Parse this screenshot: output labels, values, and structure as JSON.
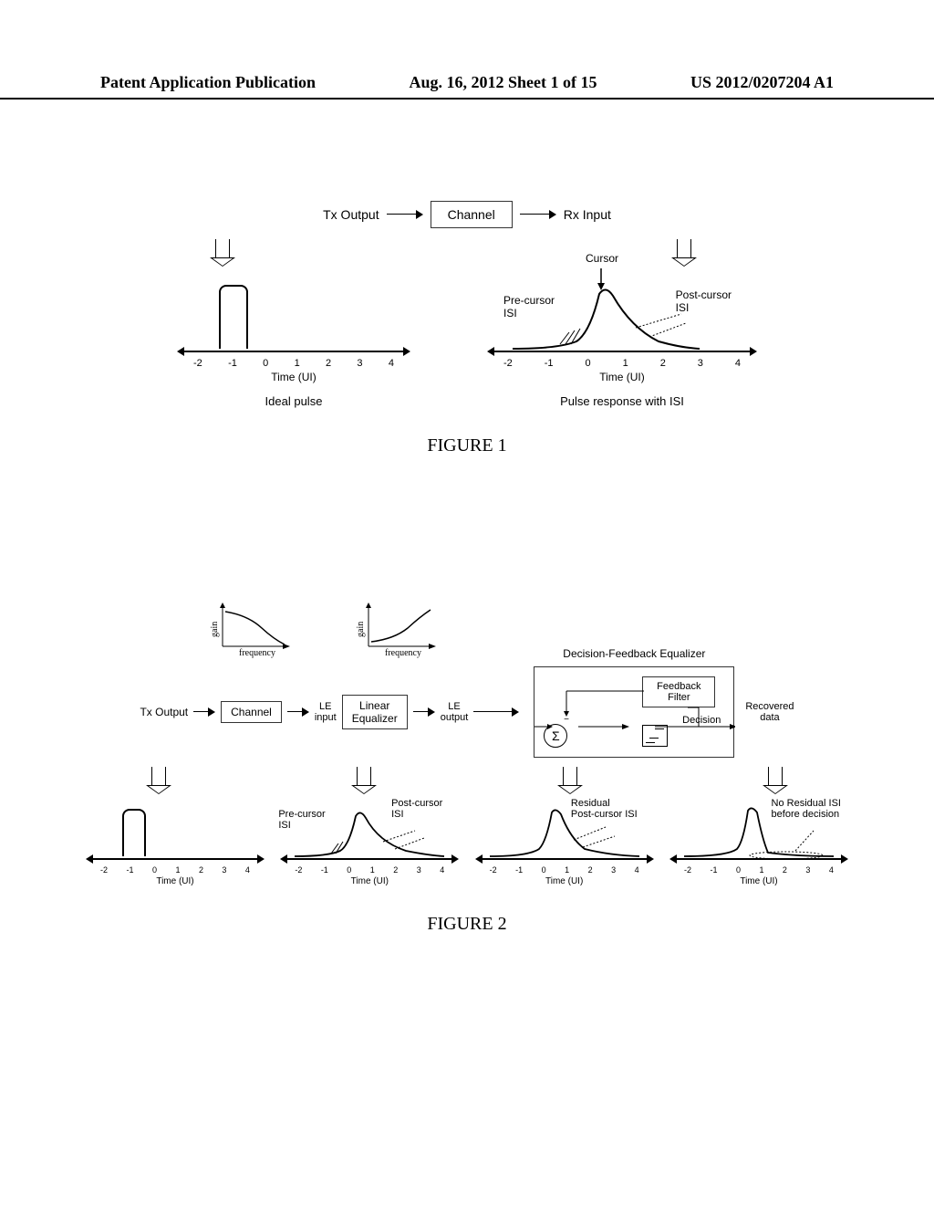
{
  "header": {
    "left": "Patent Application Publication",
    "center": "Aug. 16, 2012  Sheet 1 of 15",
    "right": "US 2012/0207204 A1"
  },
  "fig1": {
    "tx": "Tx Output",
    "channel": "Channel",
    "rx": "Rx Input",
    "cursor": "Cursor",
    "pre": "Pre-cursor\nISI",
    "post": "Post-cursor\nISI",
    "ideal": "Ideal pulse",
    "isi_title": "Pulse response with ISI",
    "time": "Time (UI)",
    "ticks": [
      "-2",
      "-1",
      "0",
      "1",
      "2",
      "3",
      "4"
    ],
    "caption": "FIGURE 1"
  },
  "fig2": {
    "tx": "Tx Output",
    "channel": "Channel",
    "le_in": "LE\ninput",
    "le": "Linear\nEqualizer",
    "le_out": "LE\noutput",
    "dfe": "Decision-Feedback Equalizer",
    "fb": "Feedback\nFilter",
    "decision": "Decision",
    "recovered": "Recovered\ndata",
    "gain": "gain",
    "frequency": "frequency",
    "pre": "Pre-cursor\nISI",
    "post": "Post-cursor\nISI",
    "residual": "Residual\nPost-cursor ISI",
    "no_residual": "No Residual ISI\nbefore decision",
    "time": "Time (UI)",
    "ticks": [
      "-2",
      "-1",
      "0",
      "1",
      "2",
      "3",
      "4"
    ],
    "caption": "FIGURE 2"
  },
  "chart_data": [
    {
      "type": "line",
      "title": "Ideal pulse",
      "xlabel": "Time (UI)",
      "x": [
        -2,
        -1,
        -0.5,
        0,
        0.5,
        1,
        2,
        3,
        4
      ],
      "y": [
        0,
        0,
        1,
        1,
        1,
        0,
        0,
        0,
        0
      ]
    },
    {
      "type": "line",
      "title": "Pulse response with ISI",
      "xlabel": "Time (UI)",
      "x": [
        -2,
        -1,
        0,
        1,
        2,
        3,
        4
      ],
      "y": [
        0.02,
        0.15,
        0.9,
        0.55,
        0.3,
        0.15,
        0.05
      ],
      "annotations": [
        "Pre-cursor ISI",
        "Cursor",
        "Post-cursor ISI"
      ]
    },
    {
      "type": "line",
      "title": "Channel gain vs frequency",
      "xlabel": "frequency",
      "ylabel": "gain",
      "x": [
        0,
        1,
        2,
        3,
        4
      ],
      "y": [
        1,
        0.8,
        0.55,
        0.3,
        0.1
      ]
    },
    {
      "type": "line",
      "title": "Linear Equalizer gain vs frequency",
      "xlabel": "frequency",
      "ylabel": "gain",
      "x": [
        0,
        1,
        2,
        3,
        4
      ],
      "y": [
        0.3,
        0.4,
        0.55,
        0.75,
        1.0
      ]
    },
    {
      "type": "line",
      "title": "LE input pulse (ISI)",
      "xlabel": "Time (UI)",
      "x": [
        -2,
        -1,
        0,
        1,
        2,
        3,
        4
      ],
      "y": [
        0.02,
        0.15,
        0.9,
        0.55,
        0.3,
        0.15,
        0.05
      ]
    },
    {
      "type": "line",
      "title": "LE output (residual post-cursor ISI)",
      "xlabel": "Time (UI)",
      "x": [
        -2,
        -1,
        0,
        1,
        2,
        3,
        4
      ],
      "y": [
        0,
        0.02,
        0.95,
        0.35,
        0.15,
        0.05,
        0.01
      ]
    },
    {
      "type": "line",
      "title": "After DFE (no residual ISI)",
      "xlabel": "Time (UI)",
      "x": [
        -2,
        -1,
        0,
        1,
        2,
        3,
        4
      ],
      "y": [
        0,
        0,
        1,
        0.05,
        0.02,
        0,
        0
      ]
    }
  ]
}
